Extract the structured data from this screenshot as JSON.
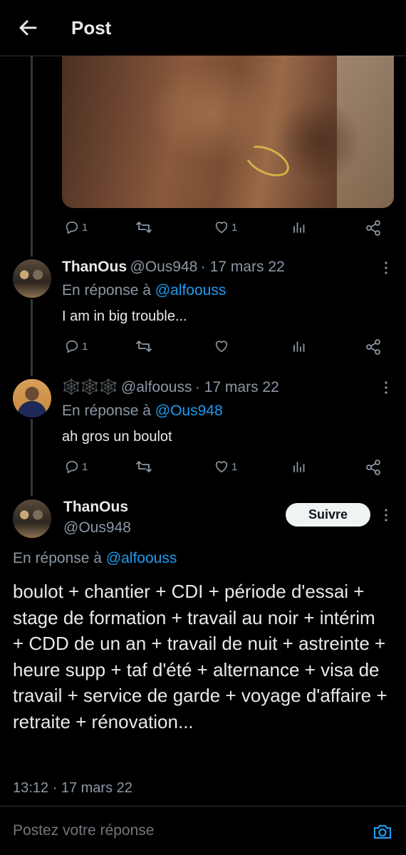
{
  "header": {
    "title": "Post"
  },
  "tweets": [
    {
      "name": "ThanOus",
      "handle": "@Ous948",
      "date": "· 17 mars 22",
      "reply_prefix": "En réponse à",
      "reply_to": "@alfoouss",
      "text": "I am in big trouble...",
      "reply_count": "1",
      "like_count": ""
    },
    {
      "name": "🕸️🕸️🕸️",
      "handle": "@alfoouss",
      "date": "· 17 mars 22",
      "reply_prefix": "En réponse à",
      "reply_to": "@Ous948",
      "text": "ah gros un boulot",
      "reply_count": "1",
      "like_count": "1"
    }
  ],
  "first_post_actions": {
    "reply_count": "1",
    "like_count": "1"
  },
  "main_tweet": {
    "name": "ThanOus",
    "handle": "@Ous948",
    "follow_label": "Suivre",
    "reply_prefix": "En réponse à",
    "reply_to": "@alfoouss",
    "text": "boulot + chantier + CDI + période d'essai + stage de formation + travail au noir + intérim + CDD de un an + travail de nuit + astreinte + heure supp + taf d'été + alternance + visa de travail + service de garde + voyage d'affaire + retraite + rénovation...",
    "timestamp": "13:12 · 17 mars 22"
  },
  "compose": {
    "placeholder": "Postez votre réponse"
  },
  "colors": {
    "background": "#000000",
    "link": "#1d9bf0",
    "muted": "#8b98a5",
    "text": "#e7e9ea"
  }
}
